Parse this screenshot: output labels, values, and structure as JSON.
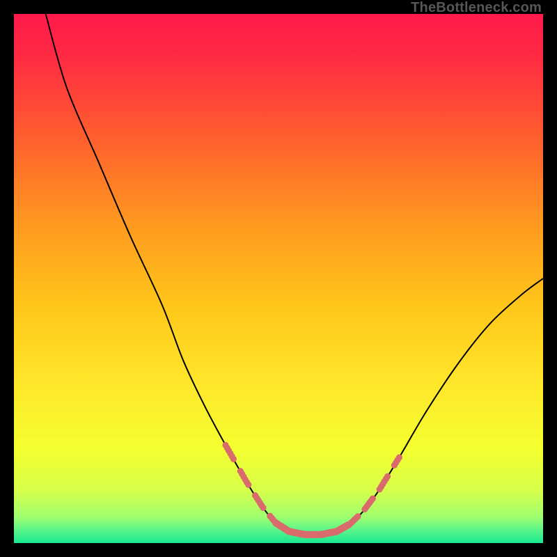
{
  "watermark": "TheBottleneck.com",
  "chart_data": {
    "type": "line",
    "title": "",
    "xlabel": "",
    "ylabel": "",
    "xlim": [
      0,
      100
    ],
    "ylim": [
      0,
      100
    ],
    "gradient_stops": [
      {
        "offset": 0.0,
        "color": "#ff1a4b"
      },
      {
        "offset": 0.08,
        "color": "#ff2a43"
      },
      {
        "offset": 0.22,
        "color": "#ff5a2f"
      },
      {
        "offset": 0.4,
        "color": "#ff9a1f"
      },
      {
        "offset": 0.55,
        "color": "#ffc61a"
      },
      {
        "offset": 0.7,
        "color": "#ffe72a"
      },
      {
        "offset": 0.82,
        "color": "#f4ff2e"
      },
      {
        "offset": 0.9,
        "color": "#d7ff4a"
      },
      {
        "offset": 0.95,
        "color": "#a0ff6e"
      },
      {
        "offset": 0.975,
        "color": "#5cf58a"
      },
      {
        "offset": 1.0,
        "color": "#18e892"
      }
    ],
    "series": [
      {
        "name": "bottleneck-curve",
        "points": [
          {
            "x": 6.0,
            "y": 100.0
          },
          {
            "x": 10.0,
            "y": 86.0
          },
          {
            "x": 16.0,
            "y": 72.0
          },
          {
            "x": 22.0,
            "y": 58.0
          },
          {
            "x": 28.0,
            "y": 45.0
          },
          {
            "x": 32.0,
            "y": 34.5
          },
          {
            "x": 36.0,
            "y": 26.0
          },
          {
            "x": 40.0,
            "y": 18.5
          },
          {
            "x": 44.0,
            "y": 11.5
          },
          {
            "x": 47.0,
            "y": 6.8
          },
          {
            "x": 49.5,
            "y": 3.8
          },
          {
            "x": 52.0,
            "y": 2.2
          },
          {
            "x": 55.0,
            "y": 1.6
          },
          {
            "x": 58.0,
            "y": 1.6
          },
          {
            "x": 61.0,
            "y": 2.2
          },
          {
            "x": 63.5,
            "y": 3.6
          },
          {
            "x": 66.0,
            "y": 6.0
          },
          {
            "x": 69.0,
            "y": 10.0
          },
          {
            "x": 73.0,
            "y": 16.5
          },
          {
            "x": 78.0,
            "y": 25.0
          },
          {
            "x": 84.0,
            "y": 34.0
          },
          {
            "x": 90.0,
            "y": 41.5
          },
          {
            "x": 96.0,
            "y": 47.0
          },
          {
            "x": 100.0,
            "y": 50.0
          }
        ]
      }
    ],
    "marker_ranges": [
      {
        "from_x": 40.0,
        "to_x": 49.5
      },
      {
        "from_x": 49.5,
        "to_x": 63.5,
        "dense": true
      },
      {
        "from_x": 63.5,
        "to_x": 73.0
      }
    ],
    "marker_color": "#d96b6c"
  }
}
